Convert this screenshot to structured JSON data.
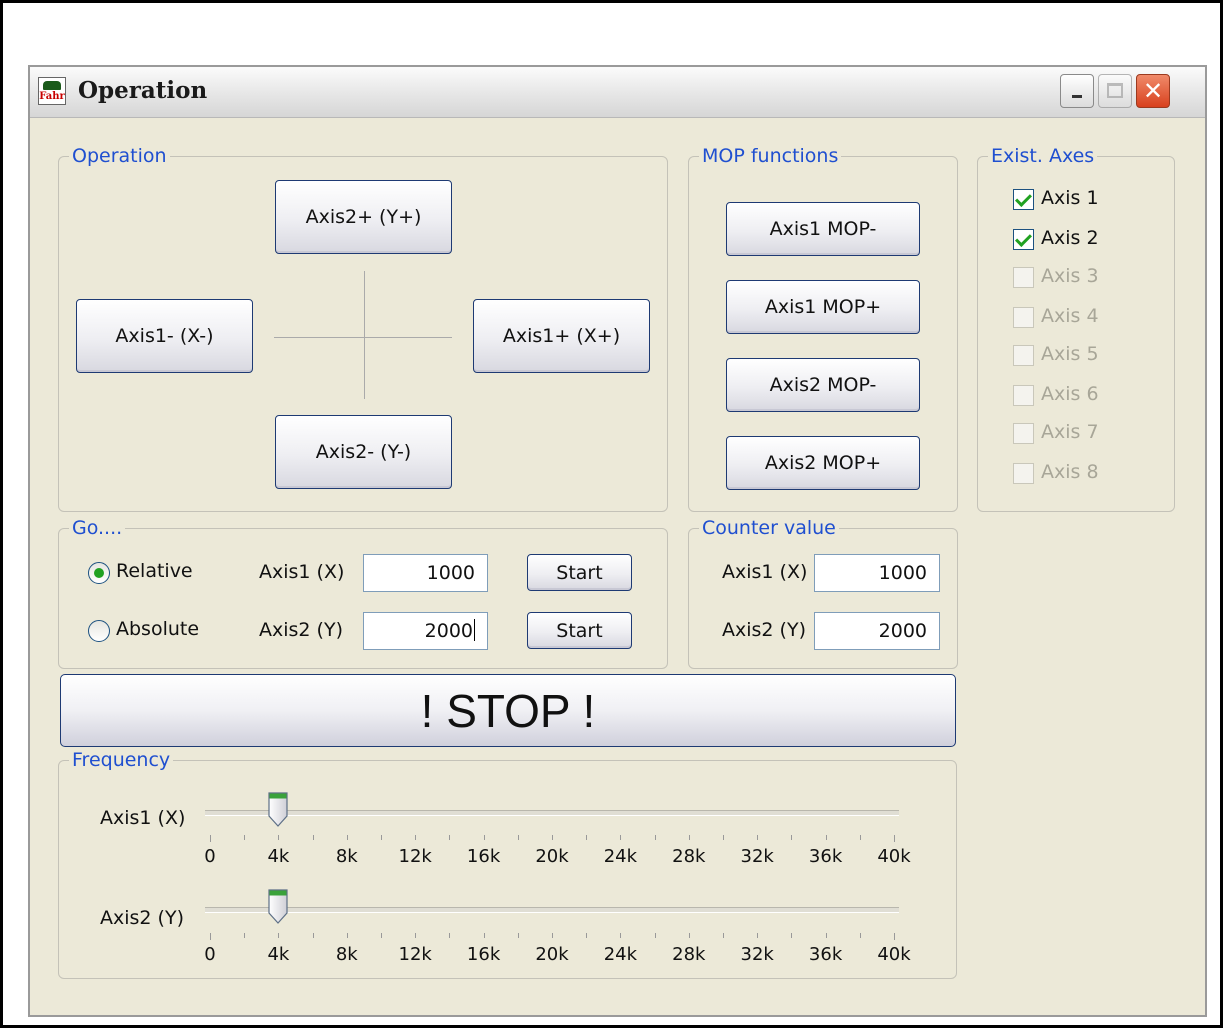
{
  "window": {
    "title": "Operation",
    "app_icon_text": "Fahr",
    "controls": [
      "minimize",
      "maximize",
      "close"
    ]
  },
  "operation": {
    "legend": "Operation",
    "axis2_plus": "Axis2+ (Y+)",
    "axis1_minus": "Axis1- (X-)",
    "axis1_plus": "Axis1+ (X+)",
    "axis2_minus": "Axis2- (Y-)"
  },
  "mop": {
    "legend": "MOP functions",
    "buttons": [
      "Axis1 MOP-",
      "Axis1 MOP+",
      "Axis2 MOP-",
      "Axis2 MOP+"
    ]
  },
  "axes": {
    "legend": "Exist. Axes",
    "items": [
      {
        "label": "Axis 1",
        "checked": true,
        "enabled": true
      },
      {
        "label": "Axis 2",
        "checked": true,
        "enabled": true
      },
      {
        "label": "Axis 3",
        "checked": false,
        "enabled": false
      },
      {
        "label": "Axis 4",
        "checked": false,
        "enabled": false
      },
      {
        "label": "Axis 5",
        "checked": false,
        "enabled": false
      },
      {
        "label": "Axis 6",
        "checked": false,
        "enabled": false
      },
      {
        "label": "Axis 7",
        "checked": false,
        "enabled": false
      },
      {
        "label": "Axis 8",
        "checked": false,
        "enabled": false
      }
    ]
  },
  "go": {
    "legend": "Go....",
    "relative_label": "Relative",
    "absolute_label": "Absolute",
    "selected_mode": "Relative",
    "axis1_label": "Axis1 (X)",
    "axis2_label": "Axis2 (Y)",
    "axis1_value": "1000",
    "axis2_value": "2000",
    "start_label": "Start"
  },
  "counter": {
    "legend": "Counter value",
    "axis1_label": "Axis1 (X)",
    "axis2_label": "Axis2 (Y)",
    "axis1_value": "1000",
    "axis2_value": "2000"
  },
  "stop": {
    "label": "! STOP !"
  },
  "frequency": {
    "legend": "Frequency",
    "axis1_label": "Axis1 (X)",
    "axis2_label": "Axis2 (Y)",
    "tick_labels": [
      "0",
      "4k",
      "8k",
      "12k",
      "16k",
      "20k",
      "24k",
      "28k",
      "32k",
      "36k",
      "40k"
    ],
    "min": 0,
    "max": 40000,
    "axis1_value": 4000,
    "axis2_value": 4000
  }
}
